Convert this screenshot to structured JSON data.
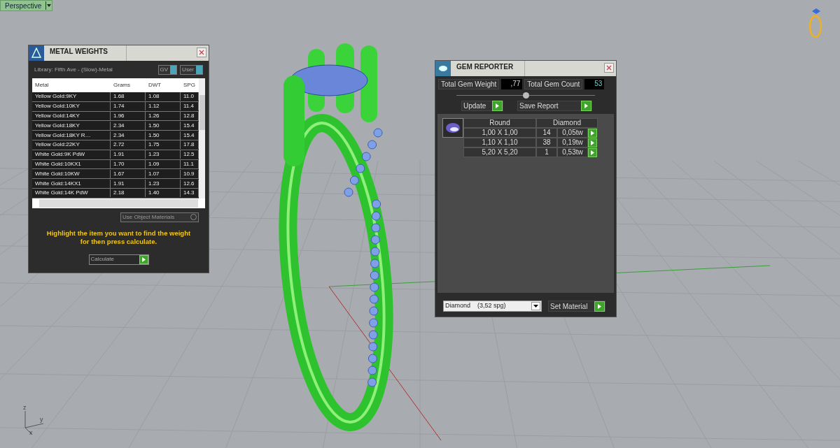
{
  "viewport": {
    "label": "Perspective",
    "axes": [
      "z",
      "y",
      "x"
    ]
  },
  "metal_weights": {
    "title": "METAL WEIGHTS",
    "library": "Library: Fifth Ave - (Slow)-Metal",
    "toggles": [
      "GV",
      "User"
    ],
    "columns": [
      "Metal",
      "Grams",
      "DWT",
      "SPG"
    ],
    "rows": [
      [
        "Yellow Gold:9KY",
        "1.68",
        "1.08",
        "11.0"
      ],
      [
        "Yellow Gold:10KY",
        "1.74",
        "1.12",
        "11.4"
      ],
      [
        "Yellow Gold:14KY",
        "1.96",
        "1.26",
        "12.8"
      ],
      [
        "Yellow Gold:18KY",
        "2.34",
        "1.50",
        "15.4"
      ],
      [
        "Yellow Gold:18KY R…",
        "2.34",
        "1.50",
        "15.4"
      ],
      [
        "Yellow Gold:22KY",
        "2.72",
        "1.75",
        "17.8"
      ],
      [
        "White Gold:9K PdW",
        "1.91",
        "1.23",
        "12.5"
      ],
      [
        "White Gold:10KX1",
        "1.70",
        "1.09",
        "11.1"
      ],
      [
        "White Gold:10KW",
        "1.67",
        "1.07",
        "10.9"
      ],
      [
        "White Gold:14KX1",
        "1.91",
        "1.23",
        "12.6"
      ],
      [
        "White Gold:14K PdW",
        "2.18",
        "1.40",
        "14.3"
      ]
    ],
    "use_object_materials": "Use Object Materials",
    "hint": "Highlight the item you want to find the weight for then press calculate.",
    "calculate": "Calculate"
  },
  "gem_reporter": {
    "title": "GEM REPORTER",
    "total_weight_label": "Total Gem Weight",
    "total_weight": ",77",
    "total_count_label": "Total Gem Count",
    "total_count": "53",
    "buttons": [
      "Update",
      "Save Report"
    ],
    "header": [
      "Round",
      "Diamond"
    ],
    "rows": [
      {
        "size": "1,00 X 1,00",
        "count": "14",
        "weight": "0,05tw"
      },
      {
        "size": "1,10 X 1,10",
        "count": "38",
        "weight": "0,19tw"
      },
      {
        "size": "5,20 X 5,20",
        "count": "1",
        "weight": "0,53tw"
      }
    ],
    "material": "Diamond    (3,52 spg)",
    "set_material": "Set Material"
  }
}
